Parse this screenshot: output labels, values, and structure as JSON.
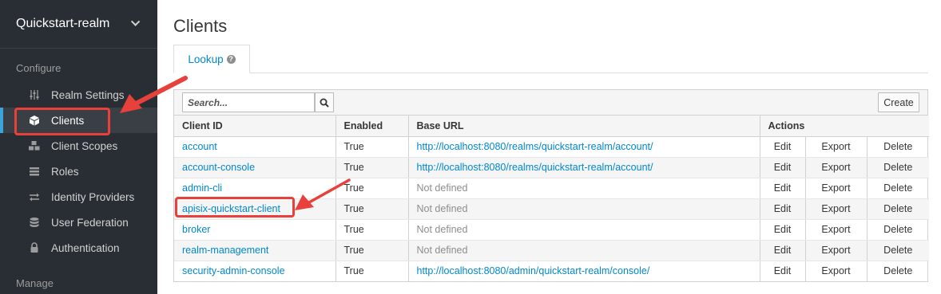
{
  "sidebar": {
    "realm_name": "Quickstart-realm",
    "configure_title": "Configure",
    "manage_title": "Manage",
    "items": [
      {
        "label": "Realm Settings",
        "icon": "sliders-icon",
        "active": false
      },
      {
        "label": "Clients",
        "icon": "cube-icon",
        "active": true
      },
      {
        "label": "Client Scopes",
        "icon": "cubes-icon",
        "active": false
      },
      {
        "label": "Roles",
        "icon": "list-icon",
        "active": false
      },
      {
        "label": "Identity Providers",
        "icon": "exchange-icon",
        "active": false
      },
      {
        "label": "User Federation",
        "icon": "database-icon",
        "active": false
      },
      {
        "label": "Authentication",
        "icon": "lock-icon",
        "active": false
      }
    ]
  },
  "main": {
    "title": "Clients",
    "tab_label": "Lookup",
    "search_placeholder": "Search...",
    "create_label": "Create",
    "columns": [
      "Client ID",
      "Enabled",
      "Base URL",
      "Actions"
    ],
    "action_labels": {
      "edit": "Edit",
      "export": "Export",
      "delete": "Delete"
    },
    "rows": [
      {
        "client_id": "account",
        "enabled": "True",
        "base_url": "http://localhost:8080/realms/quickstart-realm/account/",
        "url_defined": true
      },
      {
        "client_id": "account-console",
        "enabled": "True",
        "base_url": "http://localhost:8080/realms/quickstart-realm/account/",
        "url_defined": true
      },
      {
        "client_id": "admin-cli",
        "enabled": "True",
        "base_url": "Not defined",
        "url_defined": false
      },
      {
        "client_id": "apisix-quickstart-client",
        "enabled": "True",
        "base_url": "Not defined",
        "url_defined": false
      },
      {
        "client_id": "broker",
        "enabled": "True",
        "base_url": "Not defined",
        "url_defined": false
      },
      {
        "client_id": "realm-management",
        "enabled": "True",
        "base_url": "Not defined",
        "url_defined": false
      },
      {
        "client_id": "security-admin-console",
        "enabled": "True",
        "base_url": "http://localhost:8080/admin/quickstart-realm/console/",
        "url_defined": true
      }
    ]
  },
  "colors": {
    "sidebar_bg": "#292e34",
    "link": "#0088ce",
    "annotation": "#e8413b",
    "active_bar": "#39a5dc"
  }
}
